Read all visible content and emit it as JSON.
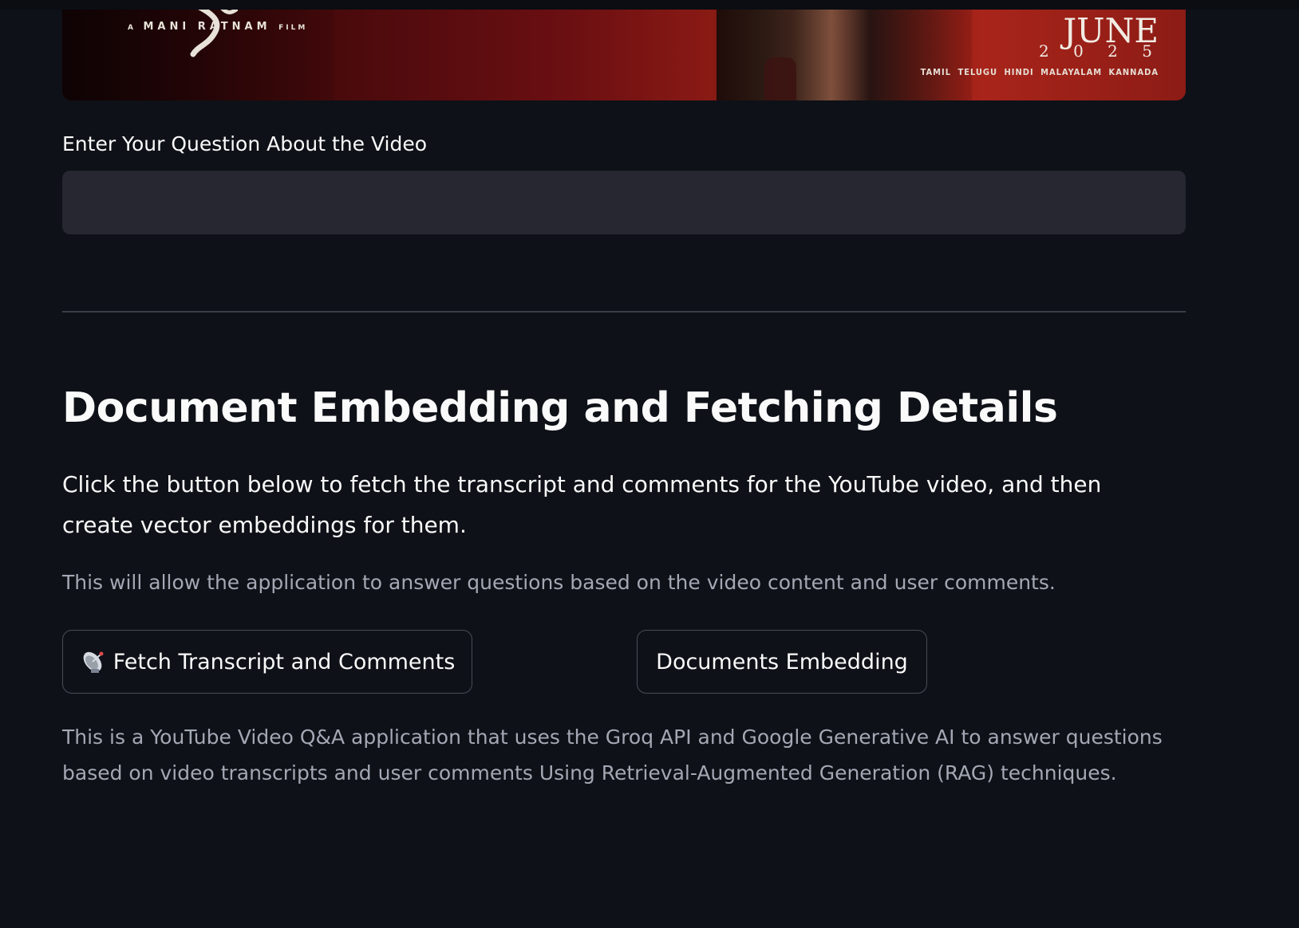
{
  "banner": {
    "credit_prefix": "A",
    "credit_name": "MANI RATNAM",
    "credit_suffix": "FILM",
    "release_month": "JUNE",
    "release_year": "2 0 2 5",
    "languages": "TAMIL TELUGU HINDI MALAYALAM KANNADA"
  },
  "question": {
    "label": "Enter Your Question About the Video",
    "value": "",
    "placeholder": ""
  },
  "section": {
    "title": "Document Embedding and Fetching Details",
    "description": "Click the button below to fetch the transcript and comments for the YouTube video, and then create vector embeddings for them.",
    "note": "This will allow the application to answer questions based on the video content and user comments."
  },
  "buttons": {
    "fetch_icon": "satellite-antenna-icon",
    "fetch_label": "Fetch Transcript and Comments",
    "embed_label": "Documents Embedding"
  },
  "footer": {
    "text": "This is a YouTube Video Q&A application that uses the Groq API and Google Generative AI to answer questions based on video transcripts and user comments Using Retrieval-Augmented Generation (RAG) techniques."
  },
  "colors": {
    "background": "#0e1117",
    "input_background": "#262730",
    "muted_text": "#a3a8b4",
    "button_border": "#4a4d57"
  }
}
